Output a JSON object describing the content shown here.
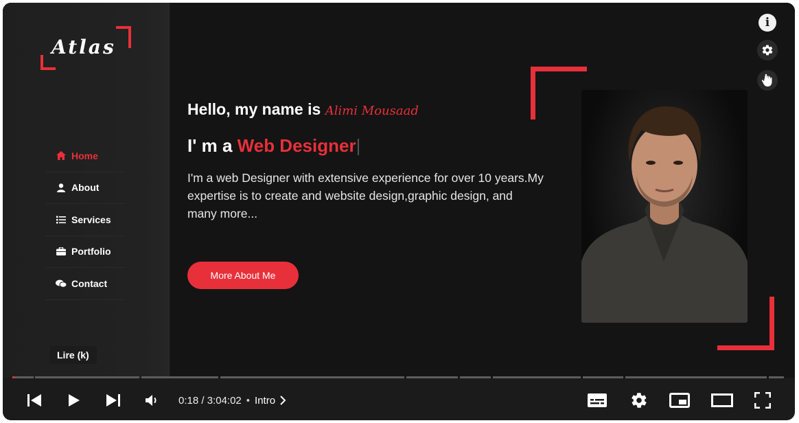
{
  "logo": {
    "text": "Atlas"
  },
  "nav": {
    "items": [
      {
        "label": "Home",
        "icon": "home-icon",
        "active": true
      },
      {
        "label": "About",
        "icon": "user-icon",
        "active": false
      },
      {
        "label": "Services",
        "icon": "list-icon",
        "active": false
      },
      {
        "label": "Portfolio",
        "icon": "briefcase-icon",
        "active": false
      },
      {
        "label": "Contact",
        "icon": "comments-icon",
        "active": false
      }
    ]
  },
  "tooltip": {
    "text": "Lire (k)"
  },
  "hero": {
    "greeting": "Hello, my name is",
    "name": "Alimi Mousaad",
    "role_prefix": "I' m a",
    "role": "Web Designer",
    "description": "I'm a web Designer with extensive experience for over 10 years.My expertise is to create and website design,graphic design, and many more...",
    "cta_label": "More About Me"
  },
  "player": {
    "current_time": "0:18",
    "duration": "3:04:02",
    "time_separator": " / ",
    "chapter": "Intro",
    "progress": 0.0016,
    "accent_color": "#e8303a",
    "overlay_icons": [
      "info-icon",
      "settings-icon",
      "hand-cursor-icon"
    ],
    "control_icons": [
      "previous-icon",
      "play-icon",
      "next-icon",
      "volume-icon",
      "subtitles-icon",
      "settings-icon",
      "miniplayer-icon",
      "theater-mode-icon",
      "fullscreen-icon"
    ]
  }
}
